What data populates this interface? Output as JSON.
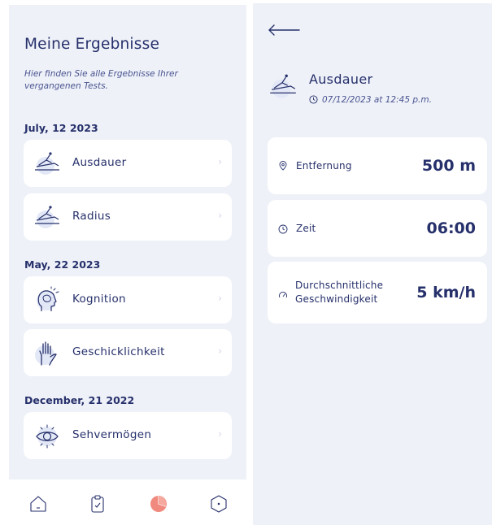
{
  "results": {
    "title": "Meine Ergebnisse",
    "subtitle": "Hier finden Sie alle Ergebnisse Ihrer vergangenen Tests.",
    "groups": [
      {
        "date": "July, 12 2023",
        "items": [
          {
            "label": "Ausdauer",
            "icon": "ski-slope-icon"
          },
          {
            "label": "Radius",
            "icon": "ski-slope-icon"
          }
        ]
      },
      {
        "date": "May, 22 2023",
        "items": [
          {
            "label": "Kognition",
            "icon": "brain-head-icon"
          },
          {
            "label": "Geschicklichkeit",
            "icon": "hand-icon"
          }
        ]
      },
      {
        "date": "December, 21 2022",
        "items": [
          {
            "label": "Sehvermögen",
            "icon": "eye-icon"
          }
        ]
      }
    ],
    "chevron": "›"
  },
  "navbar": {
    "items": [
      {
        "icon": "home-icon",
        "active": false
      },
      {
        "icon": "clipboard-check-icon",
        "active": false
      },
      {
        "icon": "pie-chart-icon",
        "active": true
      },
      {
        "icon": "hexagon-icon",
        "active": false
      }
    ]
  },
  "detail": {
    "title": "Ausdauer",
    "datetime": "07/12/2023 at 12:45 p.m.",
    "metrics": [
      {
        "icon": "location-pin-icon",
        "label": "Entfernung",
        "value": "500 m"
      },
      {
        "icon": "clock-icon",
        "label": "Zeit",
        "value": "06:00"
      },
      {
        "icon": "speedometer-icon",
        "label_lines": [
          "Durchschnittliche",
          "Geschwindigkeit"
        ],
        "value": "5 km/h"
      }
    ]
  },
  "colors": {
    "primary": "#26306b",
    "panel_bg": "#eef1f8",
    "card_bg": "#ffffff",
    "accent": "#f08a7e",
    "icon_circle": "#e3e8f7"
  }
}
